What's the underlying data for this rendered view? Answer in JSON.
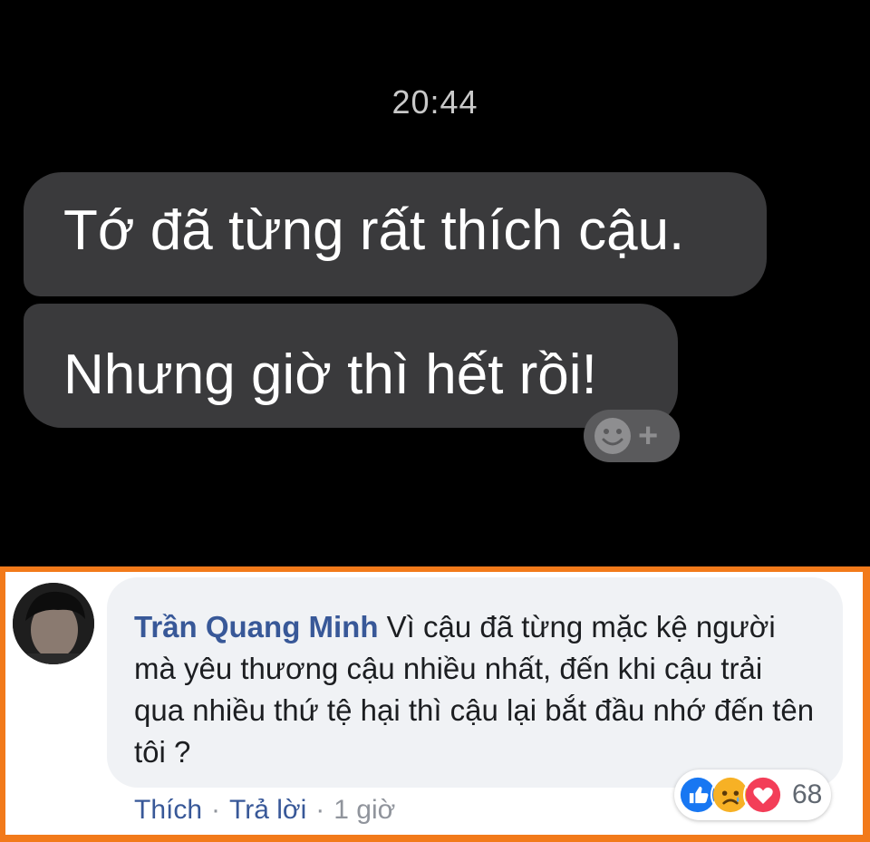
{
  "chat": {
    "time": "20:44",
    "messages": [
      {
        "text": "Tớ đã từng rất thích cậu."
      },
      {
        "text": "Nhưng giờ thì hết rồi!"
      }
    ],
    "reaction_add": {
      "icon": "smiley-icon",
      "plus": "+"
    }
  },
  "comment": {
    "author": "Trần Quang Minh",
    "text": "Vì cậu đã từng mặc kệ người mà yêu thương cậu nhiều nhất, đến khi cậu trải qua nhiều thứ tệ hại thì cậu lại bắt đầu nhớ đến tên tôi ?",
    "actions": {
      "like": "Thích",
      "reply": "Trả lời",
      "separator": "·",
      "time": "1 giờ"
    },
    "reactions": {
      "icons": [
        "like-icon",
        "sad-icon",
        "love-icon"
      ],
      "count": "68"
    }
  },
  "colors": {
    "border": "#f27a1a",
    "author": "#385898",
    "bubble": "#3a3a3c",
    "like": "#1877f2",
    "love": "#f33e58",
    "sad": "#f7b125"
  }
}
